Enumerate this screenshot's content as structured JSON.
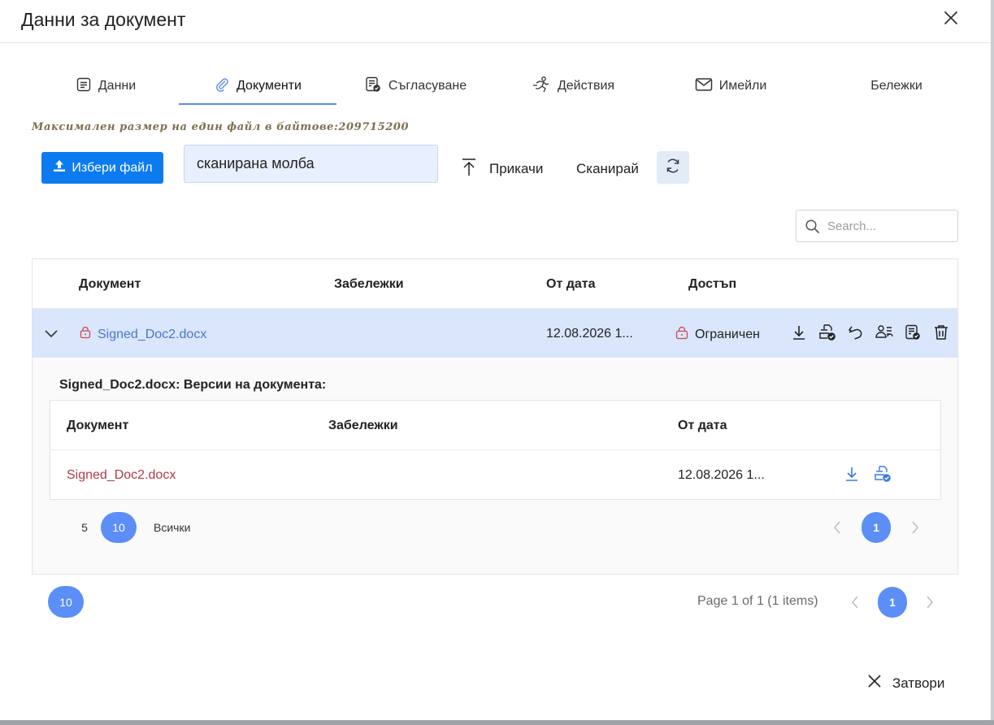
{
  "dialog": {
    "title": "Данни за документ",
    "close_button": "Затвори"
  },
  "tabs": [
    {
      "label": "Данни",
      "icon": "list-icon"
    },
    {
      "label": "Документи",
      "icon": "paperclip-icon",
      "active": true
    },
    {
      "label": "Съгласуване",
      "icon": "approval-icon"
    },
    {
      "label": "Действия",
      "icon": "running-person-icon"
    },
    {
      "label": "Имейли",
      "icon": "mail-icon"
    },
    {
      "label": "Бележки",
      "icon": ""
    }
  ],
  "upload": {
    "max_size_text": "Максимален размер на един файл в байтове:209715200",
    "pick_file_label": "Избери файл",
    "file_note_value": "сканирана молба",
    "attach_label": "Прикачи",
    "scan_label": "Сканирай"
  },
  "search": {
    "placeholder": "Search..."
  },
  "documents_grid": {
    "columns": [
      "Документ",
      "Забележки",
      "От дата",
      "Достъп"
    ],
    "rows": [
      {
        "document": "Signed_Doc2.docx",
        "notes": "",
        "date": "12.08.2026 1...",
        "access": "Ограничен",
        "actions": [
          "download-icon",
          "sign-document-icon",
          "undo-icon",
          "share-users-icon",
          "approval-icon",
          "trash-icon"
        ]
      }
    ],
    "versions": {
      "title": "Signed_Doc2.docx: Версии на документа:",
      "columns": [
        "Документ",
        "Забележки",
        "От дата"
      ],
      "rows": [
        {
          "document": "Signed_Doc2.docx",
          "notes": "",
          "date": "12.08.2026 1..."
        }
      ],
      "page_sizes": [
        "5",
        "10",
        "Всички"
      ],
      "active_page_size": "10",
      "current_page": "1"
    }
  },
  "outer_pager": {
    "page_size": "10",
    "info": "Page 1 of 1 (1 items)",
    "current_page": "1"
  },
  "colors": {
    "primary_button": "#0d7bf0",
    "pager_active": "#5b8ef7",
    "selected_row": "#d9e6fc",
    "restricted_red": "#d0454c",
    "link_blue": "#4a78c4",
    "version_link": "#b23a48"
  }
}
